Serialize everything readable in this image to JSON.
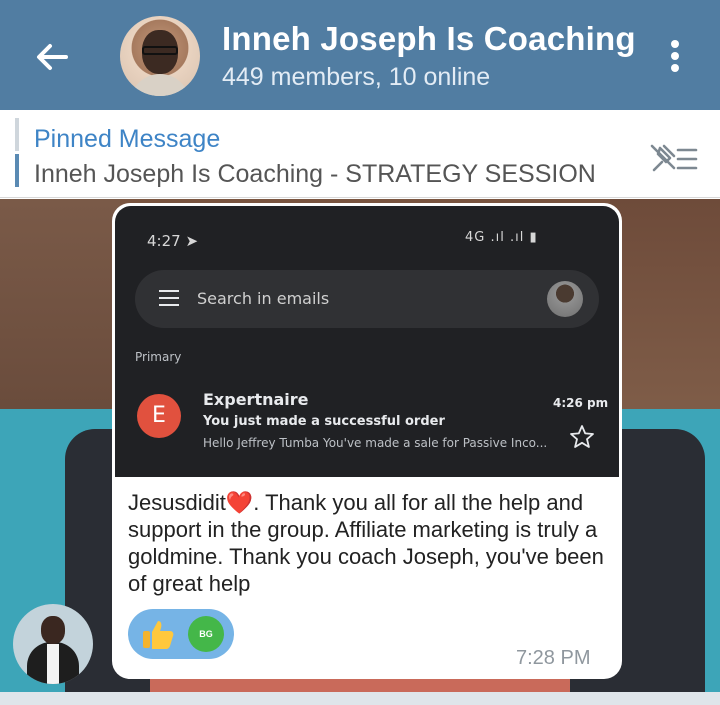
{
  "header": {
    "title": "Inneh Joseph Is Coaching",
    "subtitle": "449 members, 10 online",
    "back_icon": "arrow-left-icon",
    "more_icon": "more-vertical-icon"
  },
  "pinned": {
    "title": "Pinned Message",
    "text": "Inneh Joseph Is Coaching - STRATEGY SESSION",
    "unpin_icon": "unpin-list-icon"
  },
  "message": {
    "screenshot": {
      "time": "4:27",
      "status": "4G .ıl .ıl ▮",
      "search_placeholder": "Search in emails",
      "section_label": "Primary",
      "mail": {
        "avatar_letter": "E",
        "sender": "Expertnaire",
        "subject": "You just made a successful order",
        "preview": "Hello Jeffrey Tumba You've made a sale for Passive Inco...",
        "time": "4:26 pm"
      }
    },
    "text_before_heart": "Jesusdidit",
    "heart": "❤️",
    "text_after_heart": ". Thank you all for all the help and support in the group. Affiliate marketing is truly a goldmine. Thank you coach Joseph, you've been of great help",
    "reaction": {
      "emoji": "👍",
      "reactor_initials": "BG"
    },
    "time": "7:28 PM"
  },
  "colors": {
    "header_bg": "#517da2",
    "pinned_accent": "#3e84c6",
    "reaction_bg": "#76b4e6"
  }
}
